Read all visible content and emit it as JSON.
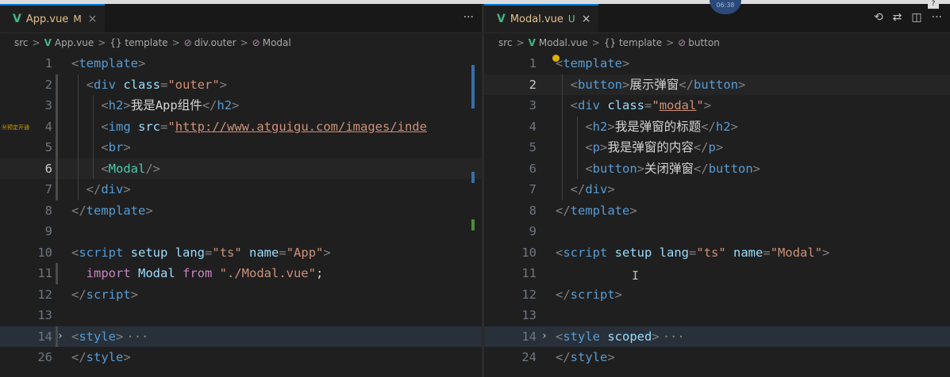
{
  "left_editor": {
    "tab": {
      "name": "App.vue",
      "state": "M",
      "close": "×"
    },
    "actions": [
      "···"
    ],
    "breadcrumb": [
      "src",
      "App.vue",
      "{} template",
      "div.outer",
      "Modal"
    ],
    "gutter_note": "Ⓜ预定开通",
    "lines": [
      {
        "n": "1",
        "tokens": [
          [
            "pun",
            "<"
          ],
          [
            "tag",
            "template"
          ],
          [
            "pun",
            ">"
          ]
        ]
      },
      {
        "n": "2",
        "tokens": [
          [
            "pun",
            "  <"
          ],
          [
            "tag",
            "div"
          ],
          [
            "attr",
            " class"
          ],
          [
            "pun",
            "="
          ],
          [
            "str",
            "\"outer\""
          ],
          [
            "pun",
            ">"
          ]
        ]
      },
      {
        "n": "3",
        "tokens": [
          [
            "pun",
            "    <"
          ],
          [
            "tag",
            "h2"
          ],
          [
            "pun",
            ">"
          ],
          [
            "txt",
            "我是App组件"
          ],
          [
            "pun",
            "</"
          ],
          [
            "tag",
            "h2"
          ],
          [
            "pun",
            ">"
          ]
        ]
      },
      {
        "n": "4",
        "tokens": [
          [
            "pun",
            "    <"
          ],
          [
            "tag",
            "img"
          ],
          [
            "attr",
            " src"
          ],
          [
            "pun",
            "="
          ],
          [
            "str",
            "\""
          ],
          [
            "url",
            "http://www.atguigu.com/images/inde"
          ]
        ]
      },
      {
        "n": "5",
        "tokens": [
          [
            "pun",
            "    <"
          ],
          [
            "tag",
            "br"
          ],
          [
            "pun",
            ">"
          ]
        ]
      },
      {
        "n": "6",
        "tokens": [
          [
            "pun",
            "    <"
          ],
          [
            "txt2",
            "Modal"
          ],
          [
            "pun",
            "/>"
          ]
        ]
      },
      {
        "n": "7",
        "tokens": [
          [
            "pun",
            "  </"
          ],
          [
            "tag",
            "div"
          ],
          [
            "pun",
            ">"
          ]
        ]
      },
      {
        "n": "8",
        "tokens": [
          [
            "pun",
            "</"
          ],
          [
            "tag",
            "template"
          ],
          [
            "pun",
            ">"
          ]
        ]
      },
      {
        "n": "9",
        "tokens": []
      },
      {
        "n": "10",
        "tokens": [
          [
            "pun",
            "<"
          ],
          [
            "tag",
            "script"
          ],
          [
            "attr",
            " setup"
          ],
          [
            "attr",
            " lang"
          ],
          [
            "pun",
            "="
          ],
          [
            "str",
            "\"ts\""
          ],
          [
            "attr",
            " name"
          ],
          [
            "pun",
            "="
          ],
          [
            "str",
            "\"App\""
          ],
          [
            "pun",
            ">"
          ]
        ]
      },
      {
        "n": "11",
        "tokens": [
          [
            "kw",
            "  import"
          ],
          [
            "ident",
            " Modal"
          ],
          [
            "kw",
            " from"
          ],
          [
            "str",
            " \"./Modal.vue\""
          ],
          [
            "txt",
            ";"
          ]
        ]
      },
      {
        "n": "12",
        "tokens": [
          [
            "pun",
            "</"
          ],
          [
            "tag",
            "script"
          ],
          [
            "pun",
            ">"
          ]
        ]
      },
      {
        "n": "13",
        "tokens": []
      },
      {
        "n": "14",
        "fold": true,
        "tokens": [
          [
            "pun",
            "<"
          ],
          [
            "tag",
            "style"
          ],
          [
            "pun",
            ">"
          ],
          [
            "ell",
            "···"
          ]
        ]
      },
      {
        "n": "26",
        "tokens": [
          [
            "pun",
            "</"
          ],
          [
            "tag",
            "style"
          ],
          [
            "pun",
            ">"
          ]
        ]
      }
    ]
  },
  "right_editor": {
    "tab": {
      "name": "Modal.vue",
      "state": "U",
      "close": "×"
    },
    "actions": [
      "history-icon",
      "compare-icon",
      "split-icon",
      "···"
    ],
    "breadcrumb": [
      "src",
      "Modal.vue",
      "{} template",
      "button"
    ],
    "lines": [
      {
        "n": "1",
        "tokens": [
          [
            "pun",
            "<"
          ],
          [
            "tag",
            "template"
          ],
          [
            "pun",
            ">"
          ]
        ]
      },
      {
        "n": "2",
        "tokens": [
          [
            "pun",
            "  <"
          ],
          [
            "tag",
            "button"
          ],
          [
            "pun",
            ">"
          ],
          [
            "txt",
            "展示弹窗"
          ],
          [
            "pun",
            "</"
          ],
          [
            "tag",
            "button"
          ],
          [
            "pun",
            ">"
          ]
        ]
      },
      {
        "n": "3",
        "tokens": [
          [
            "pun",
            "  <"
          ],
          [
            "tag",
            "div"
          ],
          [
            "attr",
            " class"
          ],
          [
            "pun",
            "="
          ],
          [
            "str",
            "\""
          ],
          [
            "url",
            "modal"
          ],
          [
            "str",
            "\""
          ],
          [
            "pun",
            ">"
          ]
        ]
      },
      {
        "n": "4",
        "tokens": [
          [
            "pun",
            "    <"
          ],
          [
            "tag",
            "h2"
          ],
          [
            "pun",
            ">"
          ],
          [
            "txt",
            "我是弹窗的标题"
          ],
          [
            "pun",
            "</"
          ],
          [
            "tag",
            "h2"
          ],
          [
            "pun",
            ">"
          ]
        ]
      },
      {
        "n": "5",
        "tokens": [
          [
            "pun",
            "    <"
          ],
          [
            "tag",
            "p"
          ],
          [
            "pun",
            ">"
          ],
          [
            "txt",
            "我是弹窗的内容"
          ],
          [
            "pun",
            "</"
          ],
          [
            "tag",
            "p"
          ],
          [
            "pun",
            ">"
          ]
        ]
      },
      {
        "n": "6",
        "tokens": [
          [
            "pun",
            "    <"
          ],
          [
            "tag",
            "button"
          ],
          [
            "pun",
            ">"
          ],
          [
            "txt",
            "关闭弹窗"
          ],
          [
            "pun",
            "</"
          ],
          [
            "tag",
            "button"
          ],
          [
            "pun",
            ">"
          ]
        ]
      },
      {
        "n": "7",
        "tokens": [
          [
            "pun",
            "  </"
          ],
          [
            "tag",
            "div"
          ],
          [
            "pun",
            ">"
          ]
        ]
      },
      {
        "n": "8",
        "tokens": [
          [
            "pun",
            "</"
          ],
          [
            "tag",
            "template"
          ],
          [
            "pun",
            ">"
          ]
        ]
      },
      {
        "n": "9",
        "tokens": []
      },
      {
        "n": "10",
        "tokens": [
          [
            "pun",
            "<"
          ],
          [
            "tag",
            "script"
          ],
          [
            "attr",
            " setup"
          ],
          [
            "attr",
            " lang"
          ],
          [
            "pun",
            "="
          ],
          [
            "str",
            "\"ts\""
          ],
          [
            "attr",
            " name"
          ],
          [
            "pun",
            "="
          ],
          [
            "str",
            "\"Modal\""
          ],
          [
            "pun",
            ">"
          ]
        ]
      },
      {
        "n": "11",
        "tokens": []
      },
      {
        "n": "12",
        "tokens": [
          [
            "pun",
            "</"
          ],
          [
            "tag",
            "script"
          ],
          [
            "pun",
            ">"
          ]
        ]
      },
      {
        "n": "13",
        "tokens": []
      },
      {
        "n": "14",
        "fold": true,
        "tokens": [
          [
            "pun",
            "<"
          ],
          [
            "tag",
            "style"
          ],
          [
            "attr",
            " scoped"
          ],
          [
            "pun",
            ">"
          ],
          [
            "ell",
            "···"
          ]
        ]
      },
      {
        "n": "24",
        "tokens": [
          [
            "pun",
            "</"
          ],
          [
            "tag",
            "style"
          ],
          [
            "pun",
            ">"
          ]
        ]
      }
    ]
  },
  "overlay": {
    "clock": "06:38",
    "help": "?"
  },
  "colors": {
    "tag": "#569cd6",
    "attr": "#9cdcfe",
    "string": "#ce9178",
    "keyword": "#c586c0",
    "vue": "#41b883",
    "modified": "#e2c08d"
  }
}
